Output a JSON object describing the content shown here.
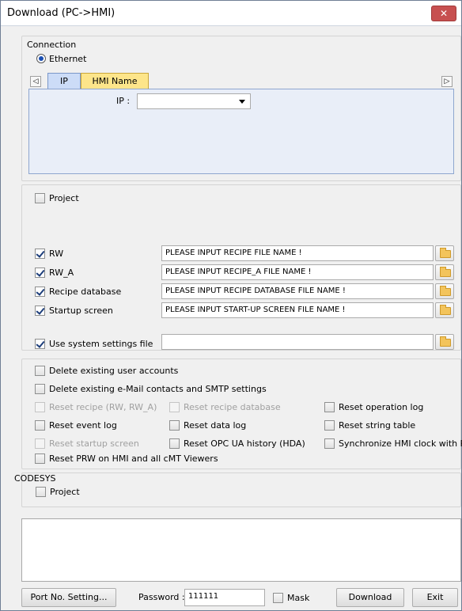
{
  "window": {
    "title": "Download (PC->HMI)",
    "close_glyph": "✕"
  },
  "connection": {
    "group_label": "Connection",
    "ethernet_label": "Ethernet",
    "tabs": [
      {
        "label": "IP"
      },
      {
        "label": "HMI Name"
      }
    ],
    "scroll_left_glyph": "◁",
    "scroll_right_glyph": "▷",
    "ip_label": "IP :",
    "ip_value": ""
  },
  "files": {
    "project_label": "Project",
    "rows": [
      {
        "label": "RW",
        "value": "PLEASE INPUT RECIPE FILE NAME !"
      },
      {
        "label": "RW_A",
        "value": "PLEASE INPUT RECIPE_A FILE NAME !"
      },
      {
        "label": "Recipe database",
        "value": "PLEASE INPUT RECIPE DATABASE FILE NAME !"
      },
      {
        "label": "Startup screen",
        "value": "PLEASE INPUT START-UP SCREEN FILE NAME !"
      }
    ],
    "system_settings_label": "Use system settings file",
    "system_settings_value": ""
  },
  "options": {
    "delete_user_accounts": "Delete existing user accounts",
    "delete_email": "Delete existing e-Mail contacts and SMTP settings",
    "reset_recipe": "Reset recipe (RW, RW_A)",
    "reset_recipe_db": "Reset recipe database",
    "reset_operation_log": "Reset operation log",
    "reset_event_log": "Reset event log",
    "reset_data_log": "Reset data log",
    "reset_string_table": "Reset string table",
    "reset_startup_screen": "Reset startup screen",
    "reset_opc_ua": "Reset OPC UA history (HDA)",
    "sync_clock": "Synchronize HMI clock with PC",
    "reset_prw": "Reset PRW on HMI and all cMT Viewers"
  },
  "codesys": {
    "group_label": "CODESYS",
    "project_label": "Project"
  },
  "footer": {
    "port_button": "Port No. Setting...",
    "password_label": "Password :",
    "password_value": "111111",
    "mask_label": "Mask",
    "download_button": "Download",
    "exit_button": "Exit"
  },
  "colors": {
    "tab_active": "#ccdcf7",
    "tab_inactive": "#fde58a"
  }
}
